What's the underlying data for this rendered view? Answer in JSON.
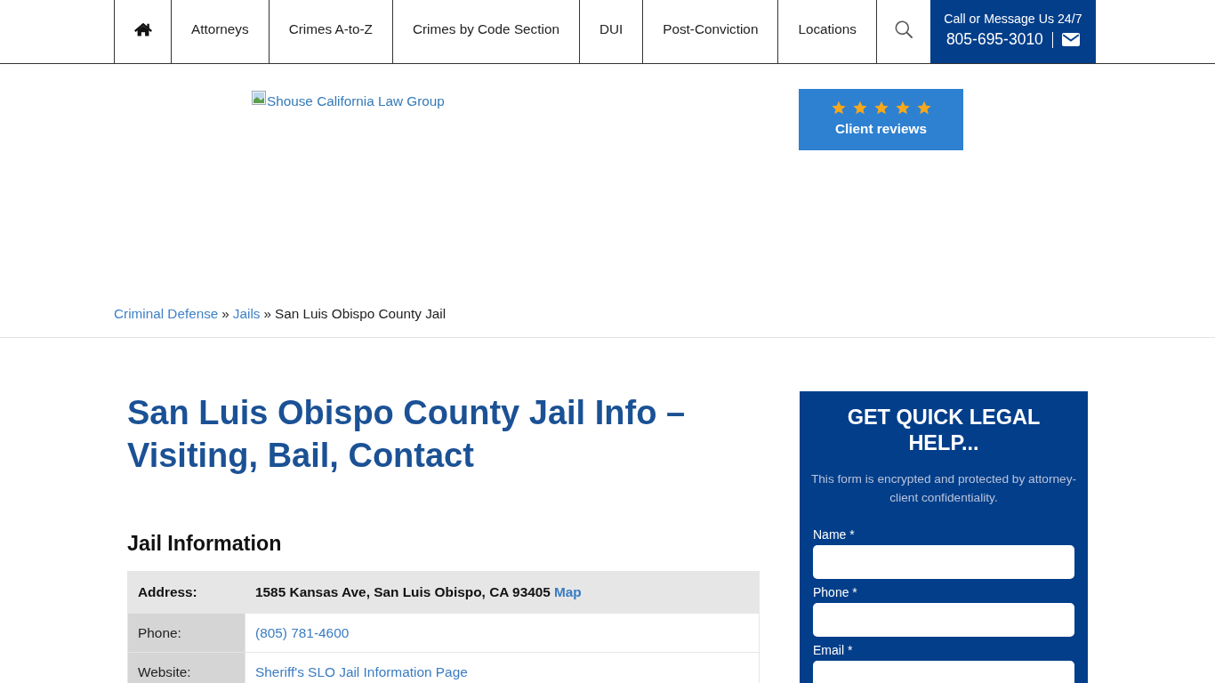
{
  "nav": {
    "links": [
      "Attorneys",
      "Crimes A-to-Z",
      "Crimes by Code Section",
      "DUI",
      "Post-Conviction",
      "Locations"
    ],
    "contact": {
      "caption": "Call or Message Us 24/7",
      "phone": "805-695-3010"
    }
  },
  "header": {
    "logo_alt": "Shouse California Law Group",
    "reviews": {
      "stars": 5,
      "label": "Client reviews"
    }
  },
  "breadcrumb": [
    {
      "kind": "link",
      "text": "Criminal Defense"
    },
    {
      "kind": "separator",
      "text": "»"
    },
    {
      "kind": "link",
      "text": "Jails"
    },
    {
      "kind": "separator",
      "text": "»"
    },
    {
      "kind": "current",
      "text": "San Luis Obispo County Jail"
    }
  ],
  "article": {
    "title": "San Luis Obispo County Jail Info – Visiting, Bail, Contact",
    "section_heading": "Jail Information",
    "table": {
      "rows": [
        {
          "kind": "emphasized",
          "label": "Address:",
          "value": "1585 Kansas Ave, San Luis Obispo, CA 93405",
          "link": "Map"
        },
        {
          "kind": "plain",
          "label": "Phone:",
          "link": "(805) 781-4600"
        },
        {
          "kind": "plain",
          "label": "Website:",
          "link": "Sheriff's SLO Jail Information Page"
        }
      ]
    }
  },
  "form": {
    "title": "GET QUICK LEGAL HELP...",
    "note": "This form is encrypted and protected by attorney-client confidentiality.",
    "fields": [
      {
        "label": "Name *"
      },
      {
        "label": "Phone *"
      },
      {
        "label": "Email *"
      }
    ]
  }
}
